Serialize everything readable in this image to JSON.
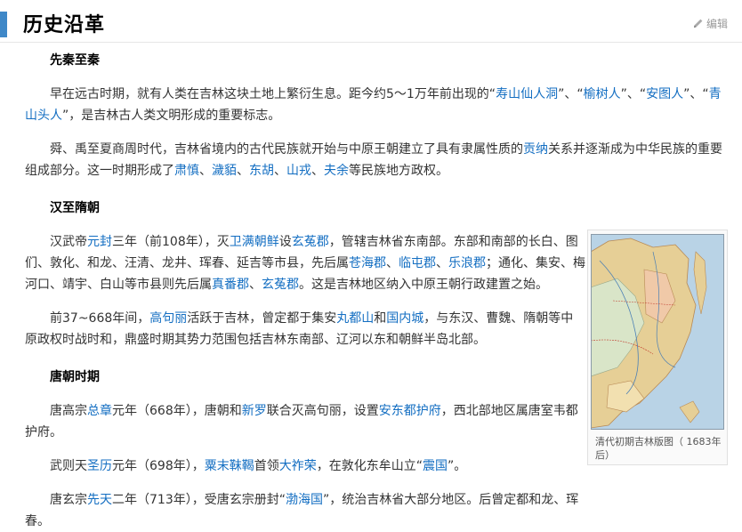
{
  "section": {
    "title": "历史沿革",
    "edit_label": "编辑"
  },
  "blocks": [
    {
      "type": "h3",
      "text": "先秦至秦"
    },
    {
      "type": "p",
      "runs": [
        {
          "t": "早在远古时期，就有人类在吉林这块土地上繁衍生息。距今约5～1万年前出现的“"
        },
        {
          "t": "寿山仙人洞",
          "link": true
        },
        {
          "t": "”、“"
        },
        {
          "t": "榆树人",
          "link": true
        },
        {
          "t": "”、“"
        },
        {
          "t": "安图人",
          "link": true
        },
        {
          "t": "”、“"
        },
        {
          "t": "青山头人",
          "link": true
        },
        {
          "t": "”，是吉林古人类文明形成的重要标志。"
        }
      ]
    },
    {
      "type": "p",
      "runs": [
        {
          "t": "舜、禹至夏商周时代，吉林省境内的古代民族就开始与中原王朝建立了具有隶属性质的"
        },
        {
          "t": "贡纳",
          "link": true
        },
        {
          "t": "关系并逐渐成为中华民族的重要组成部分。这一时期形成了"
        },
        {
          "t": "肃慎",
          "link": true
        },
        {
          "t": "、"
        },
        {
          "t": "濊貊",
          "link": true
        },
        {
          "t": "、"
        },
        {
          "t": "东胡",
          "link": true
        },
        {
          "t": "、"
        },
        {
          "t": "山戎",
          "link": true
        },
        {
          "t": "、"
        },
        {
          "t": "夫余",
          "link": true
        },
        {
          "t": "等民族地方政权。"
        }
      ]
    },
    {
      "type": "h3",
      "text": "汉至隋朝"
    },
    {
      "type": "p",
      "narrow": true,
      "runs": [
        {
          "t": "汉武帝"
        },
        {
          "t": "元封",
          "link": true
        },
        {
          "t": "三年（前108年），灭"
        },
        {
          "t": "卫满朝鲜",
          "link": true
        },
        {
          "t": "设"
        },
        {
          "t": "玄菟郡",
          "link": true
        },
        {
          "t": "，管辖吉林省东南部。东部和南部的长白、图们、敦化、和龙、汪清、龙井、珲春、延吉等市县，先后属"
        },
        {
          "t": "苍海郡",
          "link": true
        },
        {
          "t": "、"
        },
        {
          "t": "临屯郡",
          "link": true
        },
        {
          "t": "、"
        },
        {
          "t": "乐浪郡",
          "link": true
        },
        {
          "t": "；通化、集安、梅河口、靖宇、白山等市县则先后属"
        },
        {
          "t": "真番郡",
          "link": true
        },
        {
          "t": "、"
        },
        {
          "t": "玄菟郡",
          "link": true
        },
        {
          "t": "。这是吉林地区纳入中原王朝行政建置之始。"
        }
      ]
    },
    {
      "type": "p",
      "narrow": true,
      "runs": [
        {
          "t": "前37~668年间，"
        },
        {
          "t": "高句丽",
          "link": true
        },
        {
          "t": "活跃于吉林，曾定都于集安"
        },
        {
          "t": "丸都山",
          "link": true
        },
        {
          "t": "和"
        },
        {
          "t": "国内城",
          "link": true
        },
        {
          "t": "，与东汉、曹魏、隋朝等中原政权时战时和，鼎盛时期其势力范围包括吉林东南部、辽河以东和朝鲜半岛北部。"
        }
      ]
    },
    {
      "type": "h3",
      "text": "唐朝时期"
    },
    {
      "type": "p",
      "narrow": true,
      "runs": [
        {
          "t": "唐高宗"
        },
        {
          "t": "总章",
          "link": true
        },
        {
          "t": "元年（668年），唐朝和"
        },
        {
          "t": "新罗",
          "link": true
        },
        {
          "t": "联合灭高句丽，设置"
        },
        {
          "t": "安东都护府",
          "link": true
        },
        {
          "t": "，西北部地区属唐室韦都护府。"
        }
      ]
    },
    {
      "type": "p",
      "narrow": true,
      "runs": [
        {
          "t": "武则天"
        },
        {
          "t": "圣历",
          "link": true
        },
        {
          "t": "元年（698年），"
        },
        {
          "t": "粟末靺鞨",
          "link": true
        },
        {
          "t": "首领"
        },
        {
          "t": "大祚荣",
          "link": true
        },
        {
          "t": "，在敦化东牟山立“"
        },
        {
          "t": "震国",
          "link": true
        },
        {
          "t": "”。"
        }
      ]
    },
    {
      "type": "p",
      "narrow": true,
      "runs": [
        {
          "t": "唐玄宗"
        },
        {
          "t": "先天",
          "link": true
        },
        {
          "t": "二年（713年），受唐玄宗册封“"
        },
        {
          "t": "渤海国",
          "link": true
        },
        {
          "t": "”，统治吉林省大部分地区。后曾定都和龙、珲春。"
        }
      ]
    }
  ],
  "figure": {
    "caption": "清代初期吉林版图（ 1683年后）",
    "icon": "map-image"
  },
  "colors": {
    "link": "#136ec2",
    "heading_bar": "#3f88c8",
    "sea": "#b9d3e6",
    "land": "#e6cf96"
  }
}
